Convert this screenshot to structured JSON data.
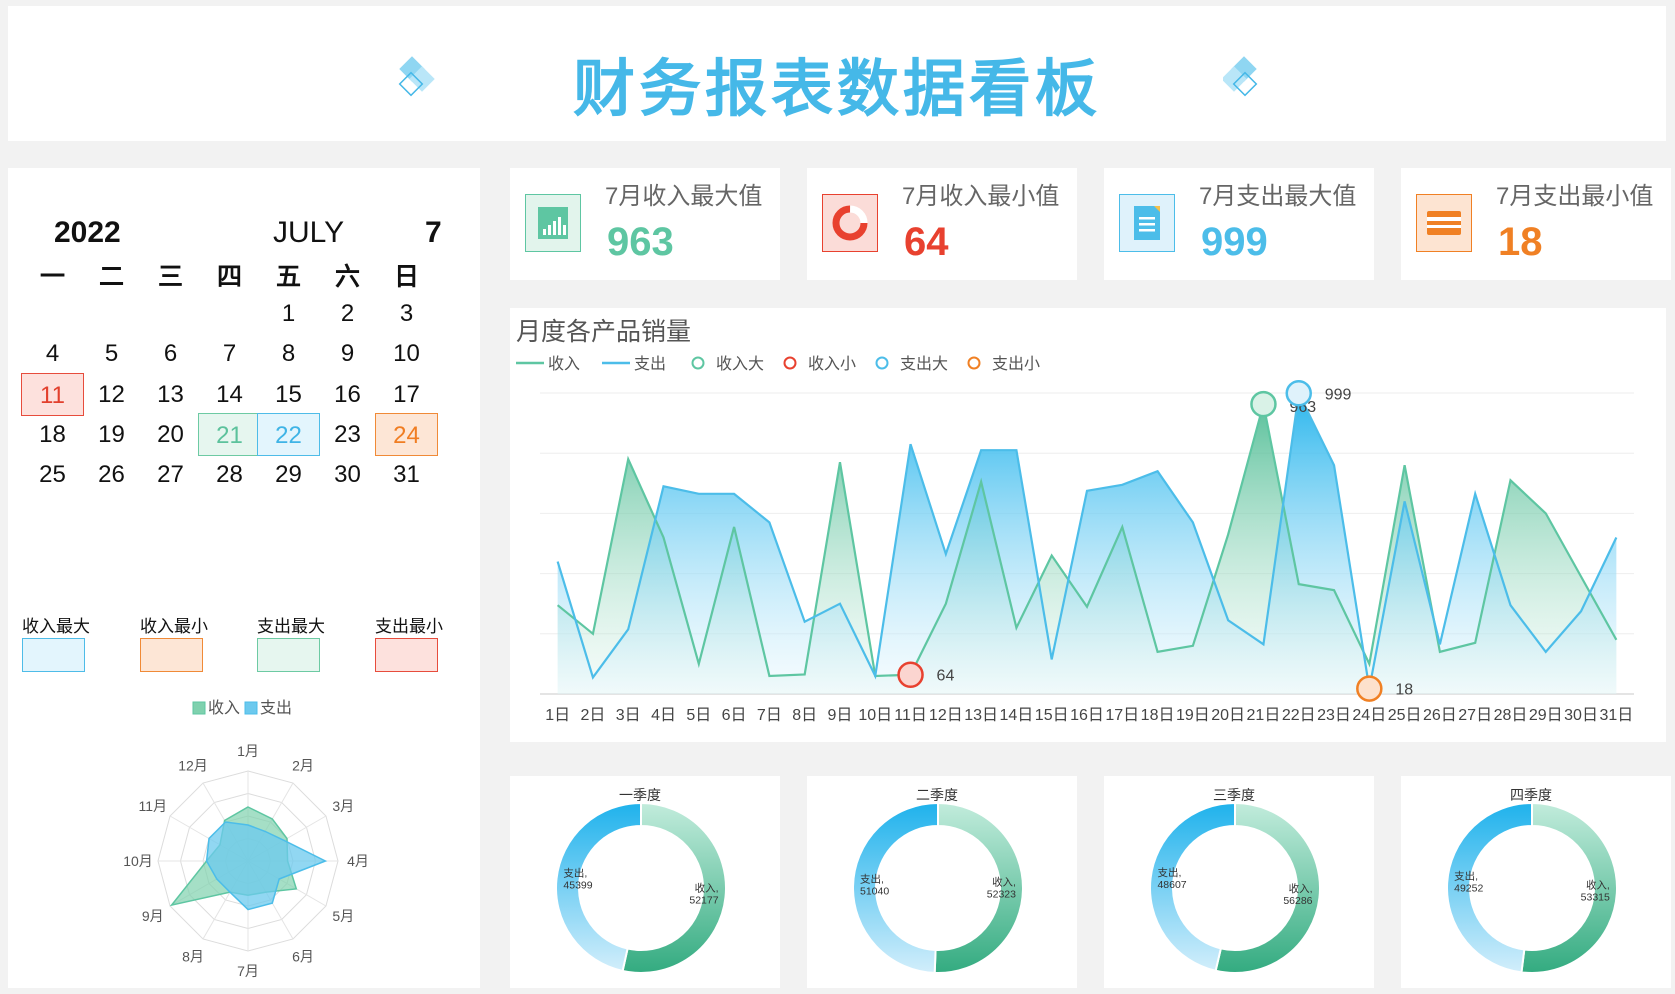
{
  "header": {
    "title": "财务报表数据看板"
  },
  "calendar": {
    "year": "2022",
    "month_name": "JULY",
    "month_num": "7",
    "weekdays": [
      "一",
      "二",
      "三",
      "四",
      "五",
      "六",
      "日"
    ],
    "days": [
      [
        "",
        "",
        "",
        "",
        "1",
        "2",
        "3"
      ],
      [
        "4",
        "5",
        "6",
        "7",
        "8",
        "9",
        "10"
      ],
      [
        "11",
        "12",
        "13",
        "14",
        "15",
        "16",
        "17"
      ],
      [
        "18",
        "19",
        "20",
        "21",
        "22",
        "23",
        "24"
      ],
      [
        "25",
        "26",
        "27",
        "28",
        "29",
        "30",
        "31"
      ]
    ],
    "highlights": {
      "income_max": "21",
      "income_min": "11",
      "expense_max": "22",
      "expense_min": "24"
    },
    "legend": [
      "收入最大",
      "收入最小",
      "支出最大",
      "支出最小"
    ]
  },
  "kpis": [
    {
      "label": "7月收入最大值",
      "value": "963",
      "color": "#5ec6a2",
      "icon": "bar-chart-icon"
    },
    {
      "label": "7月收入最小值",
      "value": "64",
      "color": "#e8412f",
      "icon": "ring-chart-icon"
    },
    {
      "label": "7月支出最大值",
      "value": "999",
      "color": "#4cbde9",
      "icon": "document-icon"
    },
    {
      "label": "7月支出最小值",
      "value": "18",
      "color": "#f08024",
      "icon": "card-icon"
    }
  ],
  "colors": {
    "income": "#5ec6a2",
    "expense": "#4cbde9",
    "income_min": "#e8412f",
    "expense_min": "#f08024"
  },
  "chart_data": [
    {
      "type": "area",
      "title": "月度各产品销量",
      "legend": [
        "收入",
        "支出",
        "收入大",
        "收入小",
        "支出大",
        "支出小"
      ],
      "categories": [
        "1日",
        "2日",
        "3日",
        "4日",
        "5日",
        "6日",
        "7日",
        "8日",
        "9日",
        "10日",
        "11日",
        "12日",
        "13日",
        "14日",
        "15日",
        "16日",
        "17日",
        "18日",
        "19日",
        "20日",
        "21日",
        "22日",
        "23日",
        "24日",
        "25日",
        "26日",
        "27日",
        "28日",
        "29日",
        "30日",
        "31日"
      ],
      "series": [
        {
          "name": "收入",
          "values": [
            295,
            200,
            780,
            520,
            100,
            555,
            60,
            65,
            770,
            60,
            64,
            300,
            705,
            220,
            460,
            290,
            555,
            140,
            160,
            530,
            963,
            365,
            345,
            100,
            760,
            140,
            170,
            710,
            600,
            390,
            180
          ]
        },
        {
          "name": "支出",
          "values": [
            440,
            55,
            215,
            690,
            665,
            665,
            570,
            240,
            300,
            60,
            830,
            465,
            810,
            810,
            115,
            675,
            695,
            740,
            570,
            245,
            165,
            999,
            760,
            18,
            640,
            165,
            665,
            295,
            140,
            275,
            520
          ]
        }
      ],
      "annotations": [
        {
          "label": "收入大",
          "x": "21日",
          "value": 963
        },
        {
          "label": "收入小",
          "x": "11日",
          "value": 64
        },
        {
          "label": "支出大",
          "x": "22日",
          "value": 999
        },
        {
          "label": "支出小",
          "x": "24日",
          "value": 18
        }
      ],
      "ylim": [
        0,
        1000
      ],
      "grid": true
    },
    {
      "type": "radar",
      "legend": [
        "收入",
        "支出"
      ],
      "categories": [
        "1月",
        "2月",
        "3月",
        "4月",
        "5月",
        "6月",
        "7月",
        "8月",
        "9月",
        "10月",
        "11月",
        "12月"
      ],
      "series": [
        {
          "name": "收入",
          "values": [
            0.6,
            0.54,
            0.5,
            0.44,
            0.62,
            0.4,
            0.38,
            0.4,
            0.98,
            0.46,
            0.36,
            0.52
          ]
        },
        {
          "name": "支出",
          "values": [
            0.4,
            0.38,
            0.46,
            0.86,
            0.4,
            0.54,
            0.54,
            0.4,
            0.4,
            0.46,
            0.5,
            0.5
          ]
        }
      ]
    },
    {
      "type": "pie",
      "title": "一季度",
      "slices": [
        {
          "name": "收入",
          "value": 52177,
          "label": "收入,\n52177"
        },
        {
          "name": "支出",
          "value": 45399,
          "label": "支出,\n45399"
        }
      ]
    },
    {
      "type": "pie",
      "title": "二季度",
      "slices": [
        {
          "name": "收入",
          "value": 52323,
          "label": "收入,\n52323"
        },
        {
          "name": "支出",
          "value": 51040,
          "label": "支出,\n51040"
        }
      ]
    },
    {
      "type": "pie",
      "title": "三季度",
      "slices": [
        {
          "name": "收入",
          "value": 56286,
          "label": "收入,\n56286"
        },
        {
          "name": "支出",
          "value": 48607,
          "label": "支出,\n48607"
        }
      ]
    },
    {
      "type": "pie",
      "title": "四季度",
      "slices": [
        {
          "name": "收入",
          "value": 53315,
          "label": "收入,\n53315"
        },
        {
          "name": "支出",
          "value": 49252,
          "label": "支出,\n49252"
        }
      ]
    }
  ]
}
